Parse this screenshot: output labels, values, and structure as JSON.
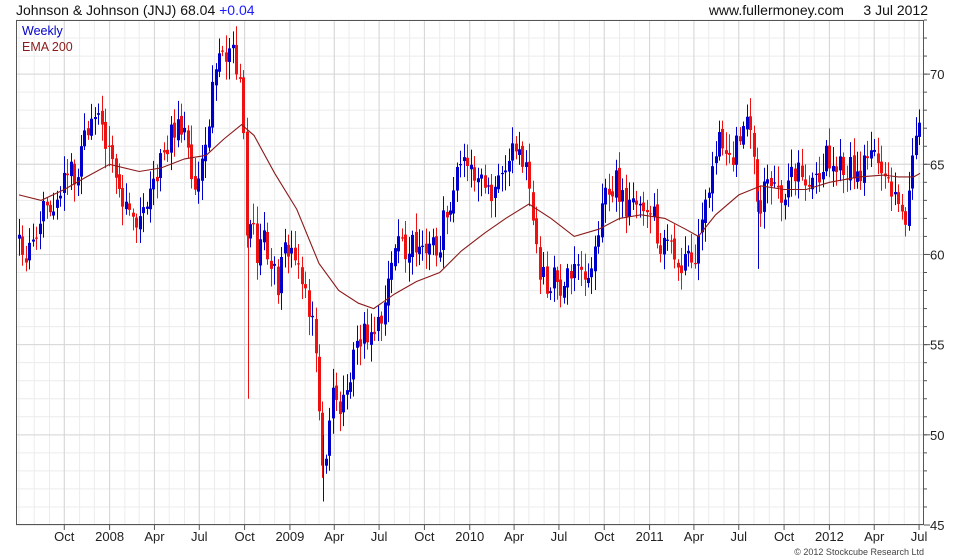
{
  "header": {
    "title": "Johnson & Johnson (JNJ) 68.04",
    "change": "+0.04",
    "site": "www.fullermoney.com",
    "date": "3 Jul 2012"
  },
  "legend": {
    "frequency": "Weekly",
    "indicator": "EMA 200"
  },
  "copyright": "© 2012 Stockcube Research Ltd",
  "colors": {
    "up": "#0000cc",
    "down": "#ee1111",
    "ema": "#8b1a1a",
    "grid": "#d6d6d6"
  },
  "chart_data": {
    "type": "line",
    "x_tick_labels": [
      "Oct",
      "2008",
      "Apr",
      "Jul",
      "Oct",
      "2009",
      "Apr",
      "Jul",
      "Oct",
      "2010",
      "Apr",
      "Jul",
      "Oct",
      "2011",
      "Apr",
      "Jul",
      "Oct",
      "2012",
      "Apr",
      "Jul"
    ],
    "y_tick_labels": [
      "45",
      "50",
      "55",
      "60",
      "65",
      "70"
    ],
    "ylim": [
      45,
      73
    ],
    "grid": true,
    "legend_position": "top-left",
    "series": [
      {
        "name": "Weekly",
        "style": "ohlc bars",
        "anchors": [
          [
            "2007-07-01",
            61.0
          ],
          [
            "2007-07-20",
            60.0
          ],
          [
            "2007-08-10",
            62.0
          ],
          [
            "2007-09-01",
            62.8
          ],
          [
            "2007-09-20",
            63.2
          ],
          [
            "2007-10-10",
            65.5
          ],
          [
            "2007-10-25",
            64.0
          ],
          [
            "2007-11-15",
            67.0
          ],
          [
            "2007-12-05",
            67.5
          ],
          [
            "2007-12-20",
            66.5
          ],
          [
            "2008-01-10",
            65.5
          ],
          [
            "2008-01-25",
            63.0
          ],
          [
            "2008-02-15",
            62.5
          ],
          [
            "2008-03-05",
            62.0
          ],
          [
            "2008-03-20",
            63.8
          ],
          [
            "2008-04-10",
            64.8
          ],
          [
            "2008-04-25",
            66.0
          ],
          [
            "2008-05-15",
            67.5
          ],
          [
            "2008-06-01",
            66.5
          ],
          [
            "2008-06-15",
            64.5
          ],
          [
            "2008-07-01",
            64.0
          ],
          [
            "2008-07-15",
            66.5
          ],
          [
            "2008-07-28",
            69.0
          ],
          [
            "2008-08-10",
            71.5
          ],
          [
            "2008-08-25",
            70.8
          ],
          [
            "2008-09-08",
            71.0
          ],
          [
            "2008-09-22",
            69.0
          ],
          [
            "2008-10-01",
            65.5
          ],
          [
            "2008-10-06",
            59.0
          ],
          [
            "2008-10-15",
            62.0
          ],
          [
            "2008-10-28",
            60.0
          ],
          [
            "2008-11-10",
            61.5
          ],
          [
            "2008-11-25",
            59.0
          ],
          [
            "2008-12-08",
            58.5
          ],
          [
            "2008-12-22",
            60.0
          ],
          [
            "2009-01-05",
            60.5
          ],
          [
            "2009-01-20",
            59.0
          ],
          [
            "2009-02-05",
            57.5
          ],
          [
            "2009-02-20",
            55.0
          ],
          [
            "2009-03-02",
            51.0
          ],
          [
            "2009-03-09",
            47.5
          ],
          [
            "2009-03-20",
            51.0
          ],
          [
            "2009-04-01",
            52.5
          ],
          [
            "2009-04-15",
            51.0
          ],
          [
            "2009-04-28",
            52.5
          ],
          [
            "2009-05-10",
            54.0
          ],
          [
            "2009-05-25",
            55.5
          ],
          [
            "2009-06-10",
            55.8
          ],
          [
            "2009-06-25",
            56.0
          ],
          [
            "2009-07-10",
            56.5
          ],
          [
            "2009-07-25",
            59.0
          ],
          [
            "2009-08-08",
            60.8
          ],
          [
            "2009-08-25",
            60.5
          ],
          [
            "2009-09-10",
            60.5
          ],
          [
            "2009-09-25",
            60.3
          ],
          [
            "2009-10-10",
            60.8
          ],
          [
            "2009-10-25",
            60.0
          ],
          [
            "2009-11-10",
            62.0
          ],
          [
            "2009-11-25",
            63.0
          ],
          [
            "2009-12-10",
            64.5
          ],
          [
            "2009-12-28",
            64.8
          ],
          [
            "2010-01-15",
            64.5
          ],
          [
            "2010-02-01",
            63.5
          ],
          [
            "2010-02-15",
            63.0
          ],
          [
            "2010-03-01",
            64.0
          ],
          [
            "2010-03-15",
            65.0
          ],
          [
            "2010-04-01",
            65.5
          ],
          [
            "2010-04-15",
            65.5
          ],
          [
            "2010-04-28",
            64.8
          ],
          [
            "2010-05-07",
            62.0
          ],
          [
            "2010-05-20",
            59.0
          ],
          [
            "2010-06-05",
            58.5
          ],
          [
            "2010-06-20",
            58.5
          ],
          [
            "2010-07-05",
            58.0
          ],
          [
            "2010-07-20",
            59.5
          ],
          [
            "2010-08-05",
            59.0
          ],
          [
            "2010-08-20",
            58.5
          ],
          [
            "2010-09-05",
            60.0
          ],
          [
            "2010-09-20",
            61.5
          ],
          [
            "2010-10-05",
            63.5
          ],
          [
            "2010-10-20",
            64.0
          ],
          [
            "2010-11-05",
            63.5
          ],
          [
            "2010-11-20",
            62.5
          ],
          [
            "2010-12-05",
            62.5
          ],
          [
            "2010-12-20",
            62.0
          ],
          [
            "2011-01-05",
            62.3
          ],
          [
            "2011-01-20",
            61.0
          ],
          [
            "2011-02-05",
            60.0
          ],
          [
            "2011-02-20",
            60.5
          ],
          [
            "2011-03-07",
            59.5
          ],
          [
            "2011-03-20",
            59.5
          ],
          [
            "2011-04-05",
            60.0
          ],
          [
            "2011-04-20",
            61.5
          ],
          [
            "2011-05-05",
            64.5
          ],
          [
            "2011-05-20",
            66.0
          ],
          [
            "2011-06-05",
            66.0
          ],
          [
            "2011-06-20",
            65.5
          ],
          [
            "2011-07-05",
            67.0
          ],
          [
            "2011-07-20",
            67.0
          ],
          [
            "2011-08-05",
            64.0
          ],
          [
            "2011-08-12",
            62.5
          ],
          [
            "2011-08-25",
            64.0
          ],
          [
            "2011-09-10",
            64.5
          ],
          [
            "2011-09-25",
            63.5
          ],
          [
            "2011-10-10",
            64.0
          ],
          [
            "2011-10-25",
            64.5
          ],
          [
            "2011-11-10",
            64.5
          ],
          [
            "2011-11-25",
            63.5
          ],
          [
            "2011-12-10",
            64.0
          ],
          [
            "2011-12-25",
            65.5
          ],
          [
            "2012-01-10",
            65.0
          ],
          [
            "2012-01-25",
            65.0
          ],
          [
            "2012-02-10",
            65.0
          ],
          [
            "2012-02-25",
            64.5
          ],
          [
            "2012-03-10",
            64.8
          ],
          [
            "2012-03-25",
            65.5
          ],
          [
            "2012-04-10",
            64.5
          ],
          [
            "2012-04-25",
            64.0
          ],
          [
            "2012-05-10",
            63.0
          ],
          [
            "2012-05-25",
            62.5
          ],
          [
            "2012-06-05",
            62.3
          ],
          [
            "2012-06-15",
            65.0
          ],
          [
            "2012-06-25",
            67.0
          ],
          [
            "2012-07-03",
            68.04
          ]
        ]
      },
      {
        "name": "EMA 200",
        "style": "line",
        "points": [
          [
            "2007-07-01",
            63.3
          ],
          [
            "2007-08-15",
            63.0
          ],
          [
            "2007-10-01",
            63.6
          ],
          [
            "2007-11-15",
            64.3
          ],
          [
            "2008-01-01",
            65.0
          ],
          [
            "2008-03-01",
            64.6
          ],
          [
            "2008-04-15",
            64.8
          ],
          [
            "2008-06-01",
            65.3
          ],
          [
            "2008-07-15",
            65.5
          ],
          [
            "2008-08-20",
            66.4
          ],
          [
            "2008-09-25",
            67.2
          ],
          [
            "2008-10-20",
            66.6
          ],
          [
            "2008-12-01",
            64.5
          ],
          [
            "2009-01-15",
            62.5
          ],
          [
            "2009-03-01",
            59.5
          ],
          [
            "2009-04-10",
            58.0
          ],
          [
            "2009-05-20",
            57.3
          ],
          [
            "2009-06-20",
            57.0
          ],
          [
            "2009-08-01",
            57.8
          ],
          [
            "2009-09-15",
            58.5
          ],
          [
            "2009-11-01",
            59.0
          ],
          [
            "2009-12-15",
            60.2
          ],
          [
            "2010-02-01",
            61.2
          ],
          [
            "2010-03-15",
            62.0
          ],
          [
            "2010-05-01",
            62.8
          ],
          [
            "2010-06-15",
            62.0
          ],
          [
            "2010-08-01",
            61.0
          ],
          [
            "2010-09-20",
            61.4
          ],
          [
            "2010-11-01",
            62.0
          ],
          [
            "2010-12-15",
            62.2
          ],
          [
            "2011-02-01",
            62.0
          ],
          [
            "2011-03-15",
            61.4
          ],
          [
            "2011-04-10",
            61.0
          ],
          [
            "2011-05-15",
            62.2
          ],
          [
            "2011-07-01",
            63.3
          ],
          [
            "2011-08-15",
            63.8
          ],
          [
            "2011-10-01",
            63.6
          ],
          [
            "2011-11-15",
            63.6
          ],
          [
            "2012-01-01",
            64.0
          ],
          [
            "2012-03-01",
            64.3
          ],
          [
            "2012-04-20",
            64.4
          ],
          [
            "2012-05-20",
            64.3
          ],
          [
            "2012-06-20",
            64.3
          ],
          [
            "2012-07-03",
            64.5
          ]
        ]
      }
    ]
  }
}
